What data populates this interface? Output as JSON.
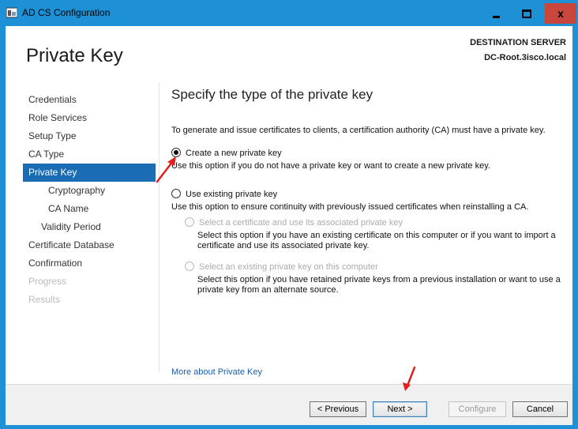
{
  "window": {
    "title": "AD CS Configuration",
    "minimize_label": "",
    "close_label": "x"
  },
  "header": {
    "page_title": "Private Key",
    "destination_label": "DESTINATION SERVER",
    "destination_server": "DC-Root.3isco.local"
  },
  "nav": {
    "items": [
      {
        "label": "Credentials"
      },
      {
        "label": "Role Services"
      },
      {
        "label": "Setup Type"
      },
      {
        "label": "CA Type"
      },
      {
        "label": "Private Key"
      },
      {
        "label": "Cryptography"
      },
      {
        "label": "CA Name"
      },
      {
        "label": "Validity Period"
      },
      {
        "label": "Certificate Database"
      },
      {
        "label": "Confirmation"
      },
      {
        "label": "Progress"
      },
      {
        "label": "Results"
      }
    ]
  },
  "content": {
    "title": "Specify the type of the private key",
    "intro": "To generate and issue certificates to clients, a certification authority (CA) must have a private key.",
    "option_new": {
      "label": "Create a new private key",
      "description": "Use this option if you do not have a private key or want to create a new private key."
    },
    "option_existing": {
      "label": "Use existing private key",
      "description": "Use this option to ensure continuity with previously issued certificates when reinstalling a CA.",
      "sub_cert": {
        "label": "Select a certificate and use its associated private key",
        "description": "Select this option if you have an existing certificate on this computer or if you want to import a certificate and use its associated private key."
      },
      "sub_key": {
        "label": "Select an existing private key on this computer",
        "description": "Select this option if you have retained private keys from a previous installation or want to use a private key from an alternate source."
      }
    },
    "more_link": "More about Private Key"
  },
  "footer": {
    "previous": "< Previous",
    "next": "Next >",
    "configure": "Configure",
    "cancel": "Cancel"
  },
  "colors": {
    "titlebar": "#1e90d6",
    "nav_active": "#1a6db4",
    "annotation_arrow": "#e02020"
  }
}
